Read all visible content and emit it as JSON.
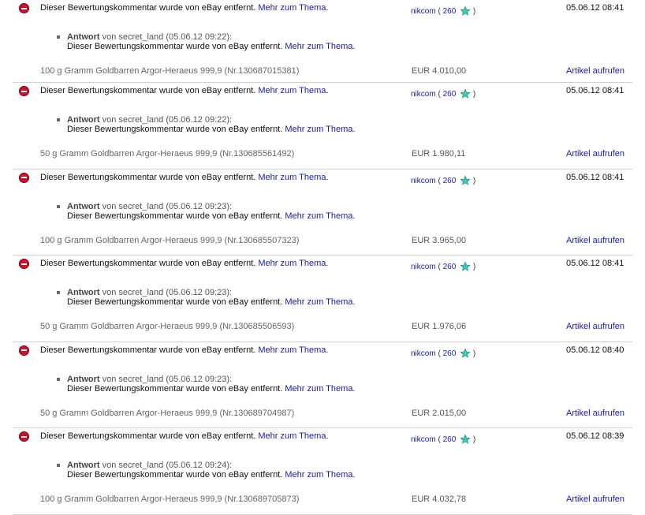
{
  "entries": [
    {
      "comment": "Dieser Bewertungskommentar wurde von eBay entfernt.",
      "more_link": "Mehr zum Thema.",
      "seller_name": "nikcom",
      "seller_score": "260",
      "date": "05.06.12 08:41",
      "reply_label": "Antwort",
      "reply_meta": "von secret_land (05.06.12 09:22):",
      "reply_text": "Dieser Bewertungskommentar wurde von eBay entfernt.",
      "reply_link": "Mehr zum Thema.",
      "item": "100 g Gramm Goldbarren Argor-Heraeus 999,9 (Nr.130687015381)",
      "price": "EUR 4.010,00",
      "view_link": "Artikel aufrufen"
    },
    {
      "comment": "Dieser Bewertungskommentar wurde von eBay entfernt.",
      "more_link": "Mehr zum Thema.",
      "seller_name": "nikcom",
      "seller_score": "260",
      "date": "05.06.12 08:41",
      "reply_label": "Antwort",
      "reply_meta": "von secret_land (05.06.12 09:22):",
      "reply_text": "Dieser Bewertungskommentar wurde von eBay entfernt.",
      "reply_link": "Mehr zum Thema.",
      "item": "50 g Gramm Goldbarren Argor-Heraeus 999,9 (Nr.130685561492)",
      "price": "EUR 1.980,11",
      "view_link": "Artikel aufrufen"
    },
    {
      "comment": "Dieser Bewertungskommentar wurde von eBay entfernt.",
      "more_link": "Mehr zum Thema.",
      "seller_name": "nikcom",
      "seller_score": "260",
      "date": "05.06.12 08:41",
      "reply_label": "Antwort",
      "reply_meta": "von secret_land (05.06.12 09:23):",
      "reply_text": "Dieser Bewertungskommentar wurde von eBay entfernt.",
      "reply_link": "Mehr zum Thema.",
      "item": "100 g Gramm Goldbarren Argor-Heraeus 999,9 (Nr.130685507323)",
      "price": "EUR 3.965,00",
      "view_link": "Artikel aufrufen"
    },
    {
      "comment": "Dieser Bewertungskommentar wurde von eBay entfernt.",
      "more_link": "Mehr zum Thema.",
      "seller_name": "nikcom",
      "seller_score": "260",
      "date": "05.06.12 08:41",
      "reply_label": "Antwort",
      "reply_meta": "von secret_land (05.06.12 09:23):",
      "reply_text": "Dieser Bewertungskommentar wurde von eBay entfernt.",
      "reply_link": "Mehr zum Thema.",
      "item": "50 g Gramm Goldbarren Argor-Heraeus 999,9 (Nr.130685506593)",
      "price": "EUR 1.976,06",
      "view_link": "Artikel aufrufen"
    },
    {
      "comment": "Dieser Bewertungskommentar wurde von eBay entfernt.",
      "more_link": "Mehr zum Thema.",
      "seller_name": "nikcom",
      "seller_score": "260",
      "date": "05.06.12 08:40",
      "reply_label": "Antwort",
      "reply_meta": "von secret_land (05.06.12 09:23):",
      "reply_text": "Dieser Bewertungskommentar wurde von eBay entfernt.",
      "reply_link": "Mehr zum Thema.",
      "item": "50 g Gramm Goldbarren Argor-Heraeus 999,9 (Nr.130689704987)",
      "price": "EUR 2.015,00",
      "view_link": "Artikel aufrufen"
    },
    {
      "comment": "Dieser Bewertungskommentar wurde von eBay entfernt.",
      "more_link": "Mehr zum Thema.",
      "seller_name": "nikcom",
      "seller_score": "260",
      "date": "05.06.12 08:39",
      "reply_label": "Antwort",
      "reply_meta": "von secret_land (05.06.12 09:24):",
      "reply_text": "Dieser Bewertungskommentar wurde von eBay entfernt.",
      "reply_link": "Mehr zum Thema.",
      "item": "100 g Gramm Goldbarren Argor-Heraeus 999,9 (Nr.130689705873)",
      "price": "EUR 4.032,78",
      "view_link": "Artikel aufrufen"
    }
  ],
  "icons": {
    "removed": "removed-icon",
    "star": "turquoise-star-icon"
  },
  "colors": {
    "link": "#1a1aa6",
    "removed_icon": "#c8102e",
    "star": "#3cc8b4"
  }
}
